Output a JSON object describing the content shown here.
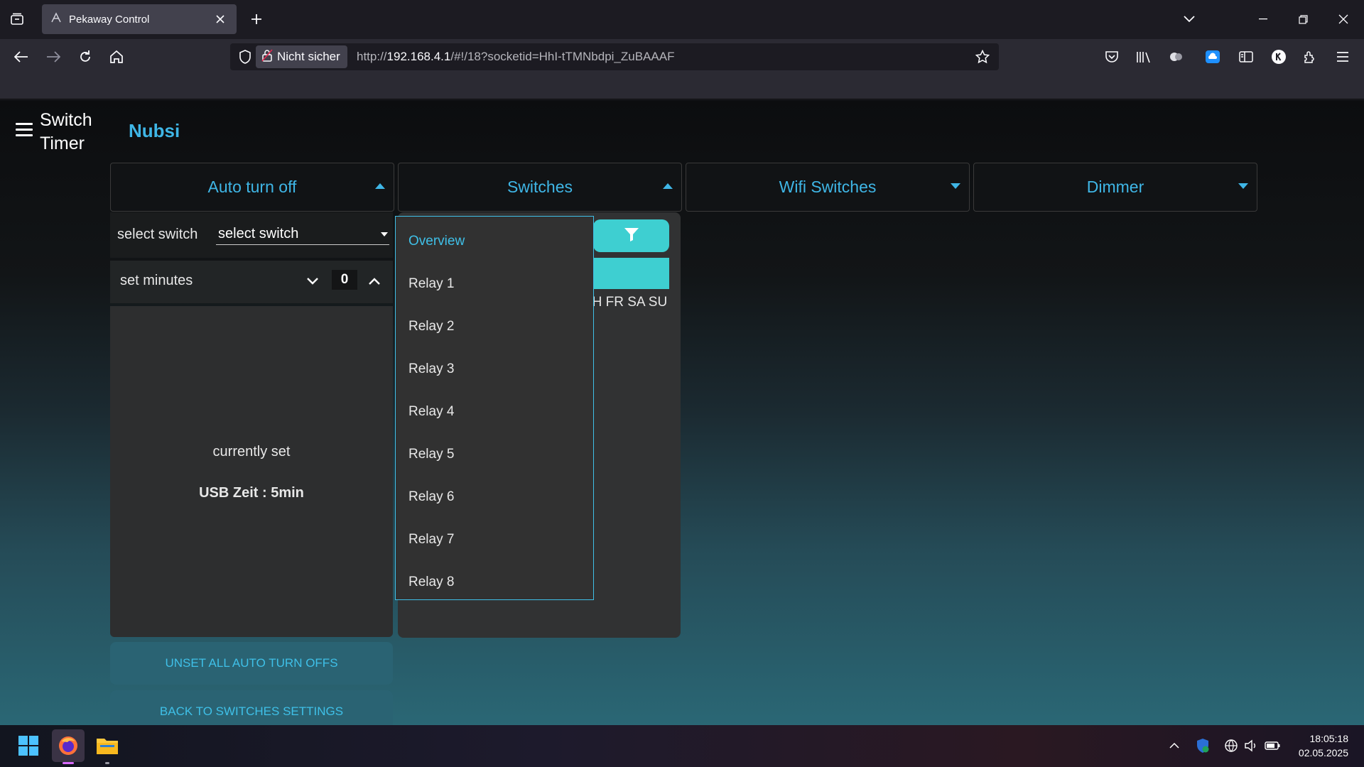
{
  "browser": {
    "tab_title": "Pekaway Control",
    "not_secure_label": "Nicht sicher",
    "url_prefix": "http://",
    "url_host": "192.168.4.1",
    "url_rest": "/#!/18?socketid=HhI-tTMNbdpi_ZuBAAAF"
  },
  "app": {
    "title_line1": "Switch",
    "title_line2": "Timer",
    "user": "Nubsi"
  },
  "sections": {
    "auto_turn_off": "Auto turn off",
    "switches": "Switches",
    "wifi_switches": "Wifi Switches",
    "dimmer": "Dimmer"
  },
  "auto_panel": {
    "select_label": "select switch",
    "select_value": "select switch",
    "minutes_label": "set minutes",
    "minutes_value": "0",
    "currently_set": "currently set",
    "usb_time": "USB Zeit : 5min",
    "unset_button": "UNSET ALL AUTO TURN OFFS",
    "back_button": "BACK TO SWITCHES SETTINGS"
  },
  "switch_panel": {
    "days_text": "TH FR SA SU"
  },
  "dropdown": {
    "items": [
      "Overview",
      "Relay 1",
      "Relay 2",
      "Relay 3",
      "Relay 4",
      "Relay 5",
      "Relay 6",
      "Relay 7",
      "Relay 8"
    ],
    "active_index": 0
  },
  "taskbar": {
    "time": "18:05:18",
    "date": "02.05.2025"
  },
  "colors": {
    "accent": "#3fb6e6",
    "teal_button": "#3ecfd1"
  }
}
